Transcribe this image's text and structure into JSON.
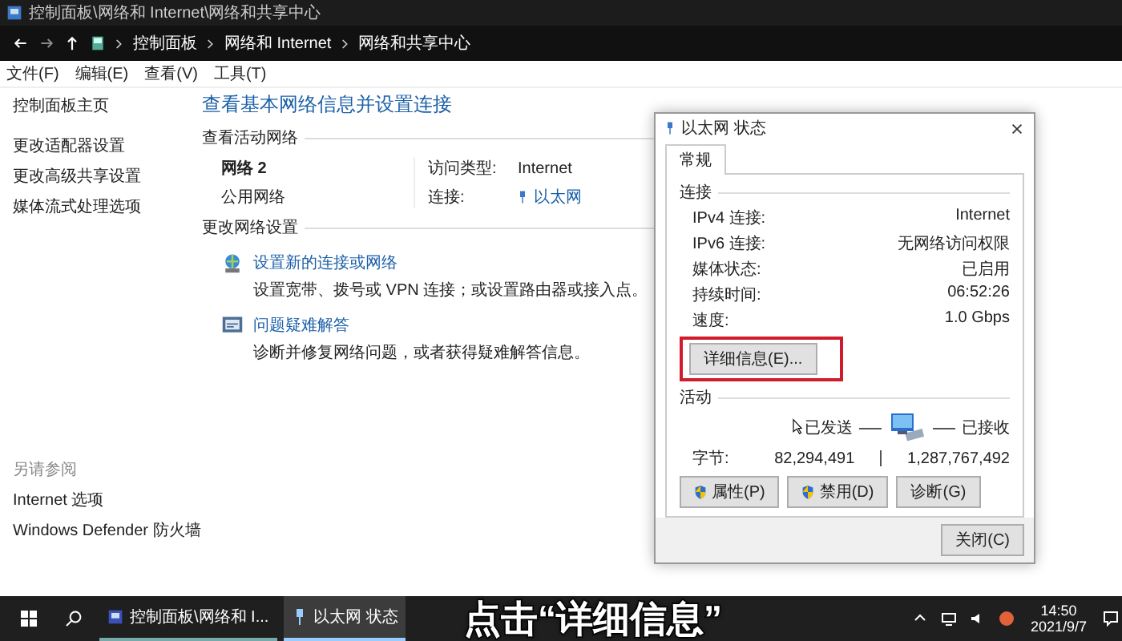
{
  "window": {
    "title": "控制面板\\网络和 Internet\\网络和共享中心",
    "breadcrumb": [
      "控制面板",
      "网络和 Internet",
      "网络和共享中心"
    ],
    "menu": [
      "文件(F)",
      "编辑(E)",
      "查看(V)",
      "工具(T)"
    ]
  },
  "sidebar": {
    "items": [
      "控制面板主页",
      "更改适配器设置",
      "更改高级共享设置",
      "媒体流式处理选项"
    ],
    "see_also_title": "另请参阅",
    "see_also": [
      "Internet 选项",
      "Windows Defender 防火墙"
    ]
  },
  "main": {
    "heading": "查看基本网络信息并设置连接",
    "active_title": "查看活动网络",
    "network_name": "网络 2",
    "network_category": "公用网络",
    "fields": [
      {
        "label": "访问类型:",
        "value": "Internet",
        "kind": "text"
      },
      {
        "label": "连接:",
        "value": "以太网",
        "kind": "link"
      }
    ],
    "change_title": "更改网络设置",
    "tasks": [
      {
        "link": "设置新的连接或网络",
        "description": "设置宽带、拨号或 VPN 连接；或设置路由器或接入点。",
        "kind": "setup"
      },
      {
        "link": "问题疑难解答",
        "description": "诊断并修复网络问题，或者获得疑难解答信息。",
        "kind": "troubleshoot"
      }
    ]
  },
  "dialog": {
    "title": "以太网 状态",
    "tabs": [
      {
        "label": "常规",
        "selected": true
      }
    ],
    "connection_title": "连接",
    "rows": [
      {
        "label": "IPv4 连接:",
        "value": "Internet"
      },
      {
        "label": "IPv6 连接:",
        "value": "无网络访问权限"
      },
      {
        "label": "媒体状态:",
        "value": "已启用"
      },
      {
        "label": "持续时间:",
        "value": "06:52:26"
      },
      {
        "label": "速度:",
        "value": "1.0 Gbps"
      }
    ],
    "details_button": "详细信息(E)...",
    "highlighted": true,
    "activity_title": "活动",
    "sent_label": "已发送",
    "received_label": "已接收",
    "bytes_label": "字节:",
    "sent": "82,294,491",
    "received": "1,287,767,492",
    "buttons": [
      {
        "label": "属性(P)",
        "shield": true
      },
      {
        "label": "禁用(D)",
        "shield": true
      },
      {
        "label": "诊断(G)",
        "shield": false
      }
    ],
    "close_button": "关闭(C)"
  },
  "taskbar": {
    "items": [
      {
        "label": "控制面板\\网络和 I...",
        "kind": "panel",
        "selected": false
      },
      {
        "label": "以太网 状态",
        "kind": "ethernet",
        "selected": true
      }
    ],
    "time": "14:50",
    "date": "2021/9/7"
  },
  "caption": "点击“详细信息”"
}
